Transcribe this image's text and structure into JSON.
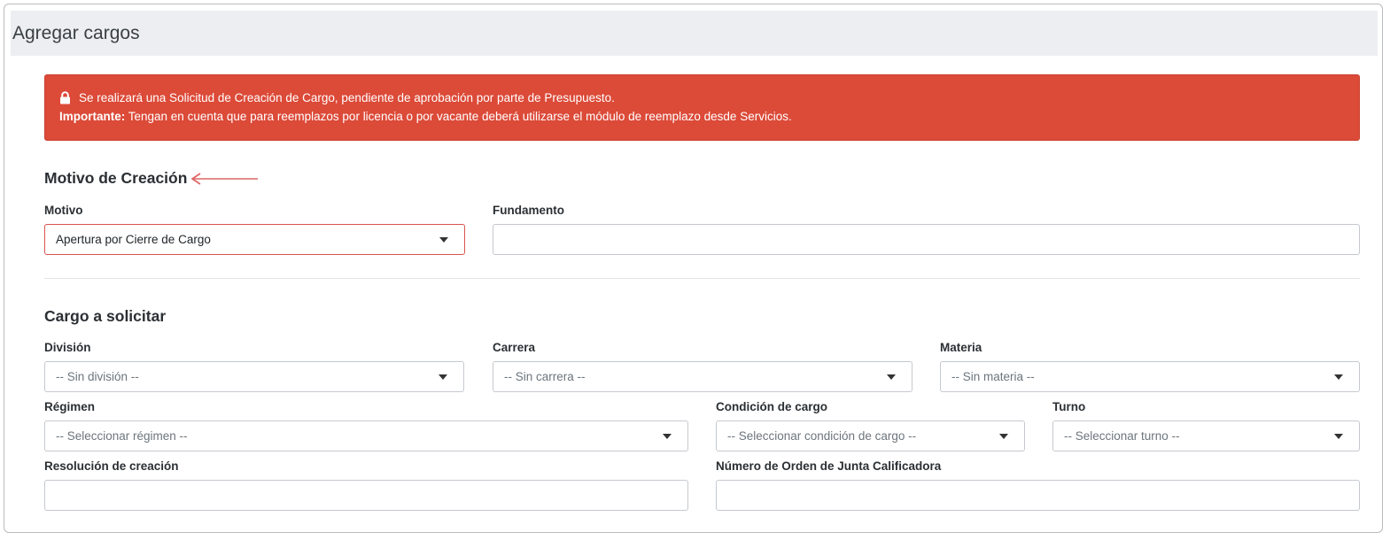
{
  "header": {
    "title": "Agregar cargos"
  },
  "alert": {
    "line1": "Se realizará una Solicitud de Creación de Cargo, pendiente de aprobación por parte de Presupuesto.",
    "important_label": "Importante:",
    "line2": " Tengan en cuenta que para reemplazos por licencia o por vacante deberá utilizarse el módulo de reemplazo desde Servicios.",
    "icon": "lock-icon",
    "color": "#dc4a38"
  },
  "motivo_section": {
    "title": "Motivo de Creación",
    "motivo": {
      "label": "Motivo",
      "value": "Apertura por Cierre de Cargo"
    },
    "fundamento": {
      "label": "Fundamento",
      "value": ""
    }
  },
  "cargo_section": {
    "title": "Cargo a solicitar",
    "division": {
      "label": "División",
      "value": "-- Sin división --"
    },
    "carrera": {
      "label": "Carrera",
      "value": "-- Sin carrera --"
    },
    "materia": {
      "label": "Materia",
      "value": "-- Sin materia --"
    },
    "regimen": {
      "label": "Régimen",
      "value": "-- Seleccionar régimen --"
    },
    "condicion": {
      "label": "Condición de cargo",
      "value": "-- Seleccionar condición de cargo --"
    },
    "turno": {
      "label": "Turno",
      "value": "-- Seleccionar turno --"
    },
    "resolucion": {
      "label": "Resolución de creación",
      "value": ""
    },
    "numero_orden": {
      "label": "Número de Orden de Junta Calificadora",
      "value": ""
    }
  },
  "colors": {
    "accent_red": "#d9534f",
    "arrow": "#e06666"
  }
}
